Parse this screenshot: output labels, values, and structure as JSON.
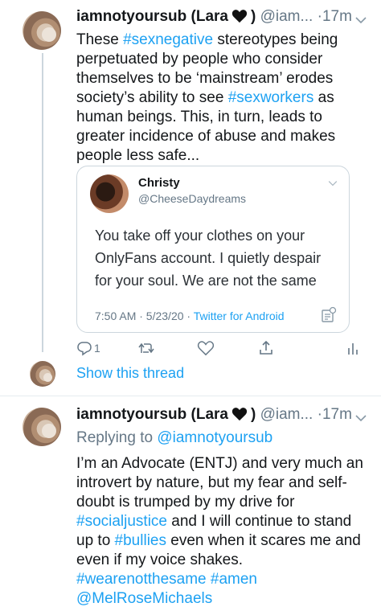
{
  "tweet1": {
    "name": "iamnotyoursub (Lara",
    "name_close": ")",
    "handle": "@iam...",
    "dot": "·",
    "time": "17m",
    "text_parts": [
      {
        "t": "These "
      },
      {
        "t": "#sexnegative",
        "tag": true
      },
      {
        "t": " stereotypes being perpetuated by people who consider themselves to be ‘mainstream’ erodes society’s ability to see "
      },
      {
        "t": "#sexworkers",
        "tag": true
      },
      {
        "t": " as human beings. This, in turn, leads to greater incidence of abuse and makes people less safe..."
      }
    ]
  },
  "quote": {
    "name": "Christy",
    "handle": "@CheeseDaydreams",
    "text": "You take off your clothes on your OnlyFans account. I quietly despair for your soul. We are not the same",
    "timestamp": "7:50 AM · 5/23/20 · ",
    "source": "Twitter for Android"
  },
  "actions": {
    "reply_count": "1"
  },
  "show_thread": "Show this thread",
  "tweet2": {
    "name": "iamnotyoursub (Lara",
    "name_close": ")",
    "handle": "@iam...",
    "dot": "·",
    "time": "17m",
    "replying_label": "Replying to ",
    "replying_handle": "@iamnotyoursub",
    "text_parts": [
      {
        "t": "I’m an Advocate (ENTJ) and very much an introvert by nature, but my fear and self-doubt is trumped by my drive for "
      },
      {
        "t": "#socialjustice",
        "tag": true
      },
      {
        "t": " and I will continue to stand up to "
      },
      {
        "t": "#bullies",
        "tag": true
      },
      {
        "t": " even when it scares me and even if my voice shakes. "
      },
      {
        "t": "#wearenotthesame",
        "tag": true
      },
      {
        "t": " "
      },
      {
        "t": "#amen",
        "tag": true
      },
      {
        "t": " "
      },
      {
        "t": "@MelRoseMichaels",
        "tag": true
      }
    ]
  },
  "colors": {
    "link": "#1da1f2",
    "muted": "#657786",
    "text": "#14171a",
    "border": "#ccd6dd"
  },
  "icons": [
    "black-heart-icon",
    "chevron-down-icon",
    "reply-icon",
    "retweet-icon",
    "like-icon",
    "share-icon",
    "analytics-icon",
    "stats-icon"
  ]
}
